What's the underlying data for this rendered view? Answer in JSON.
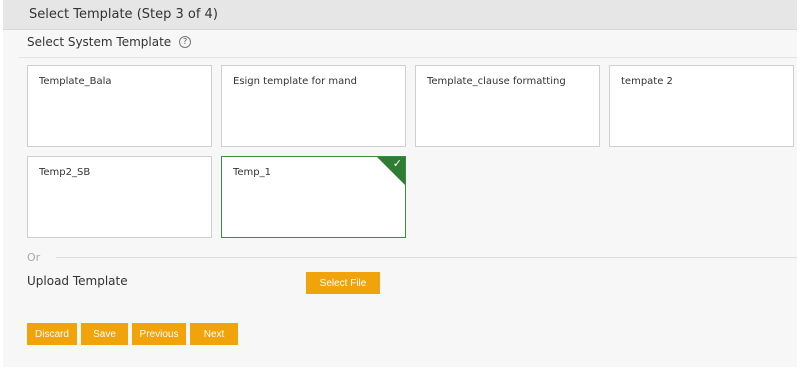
{
  "header": {
    "title": "Select Template (Step 3 of 4)"
  },
  "section": {
    "title": "Select System Template",
    "help_icon": "question-circle-icon"
  },
  "templates": [
    {
      "label": "Template_Bala",
      "selected": false
    },
    {
      "label": "Esign template for mand",
      "selected": false
    },
    {
      "label": "Template_clause formatting",
      "selected": false
    },
    {
      "label": "tempate 2",
      "selected": false
    },
    {
      "label": "Temp2_SB",
      "selected": false
    },
    {
      "label": "Temp_1",
      "selected": true
    }
  ],
  "or_text": "Or",
  "upload": {
    "label": "Upload Template",
    "select_file_label": "Select File"
  },
  "actions": {
    "discard": "Discard",
    "save": "Save",
    "previous": "Previous",
    "next": "Next"
  },
  "colors": {
    "accent": "#f0a30a",
    "selected_border": "#2e7d32",
    "header_bg": "#e6e6e6"
  }
}
